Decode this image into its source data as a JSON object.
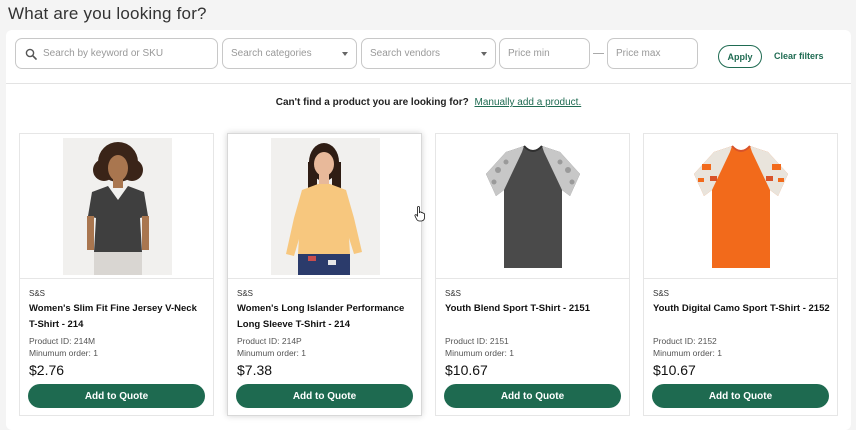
{
  "page_title": "What are you looking for?",
  "filters": {
    "search_placeholder": "Search by keyword or SKU",
    "categories_placeholder": "Search categories",
    "vendors_placeholder": "Search vendors",
    "price_min_placeholder": "Price min",
    "price_max_placeholder": "Price max",
    "apply_label": "Apply",
    "clear_label": "Clear filters"
  },
  "notice": {
    "question": "Can't find a product you are looking for?",
    "link": "Manually add a product."
  },
  "products": [
    {
      "vendor": "S&S",
      "name": "Women's Slim Fit Fine Jersey V-Neck T-Shirt - 214",
      "product_id": "Product ID: 214M",
      "min_order": "Minumum order: 1",
      "price": "$2.76",
      "button": "Add to Quote"
    },
    {
      "vendor": "S&S",
      "name": "Women's Long Islander Performance Long Sleeve T-Shirt - 214",
      "product_id": "Product ID: 214P",
      "min_order": "Minumum order: 1",
      "price": "$7.38",
      "button": "Add to Quote"
    },
    {
      "vendor": "S&S",
      "name": "Youth Blend Sport T-Shirt - 2151",
      "product_id": "Product ID: 2151",
      "min_order": "Minumum order: 1",
      "price": "$10.67",
      "button": "Add to Quote"
    },
    {
      "vendor": "S&S",
      "name": "Youth Digital Camo Sport T-Shirt - 2152",
      "product_id": "Product ID: 2152",
      "min_order": "Minumum order: 1",
      "price": "$10.67",
      "button": "Add to Quote"
    }
  ],
  "colors": {
    "brand_green": "#1e6a50",
    "shirt_black": "#3f3f3f",
    "shirt_yellow": "#f7c77e",
    "shirt_charcoal": "#4a4a4a",
    "shirt_orange": "#f26a1b"
  }
}
